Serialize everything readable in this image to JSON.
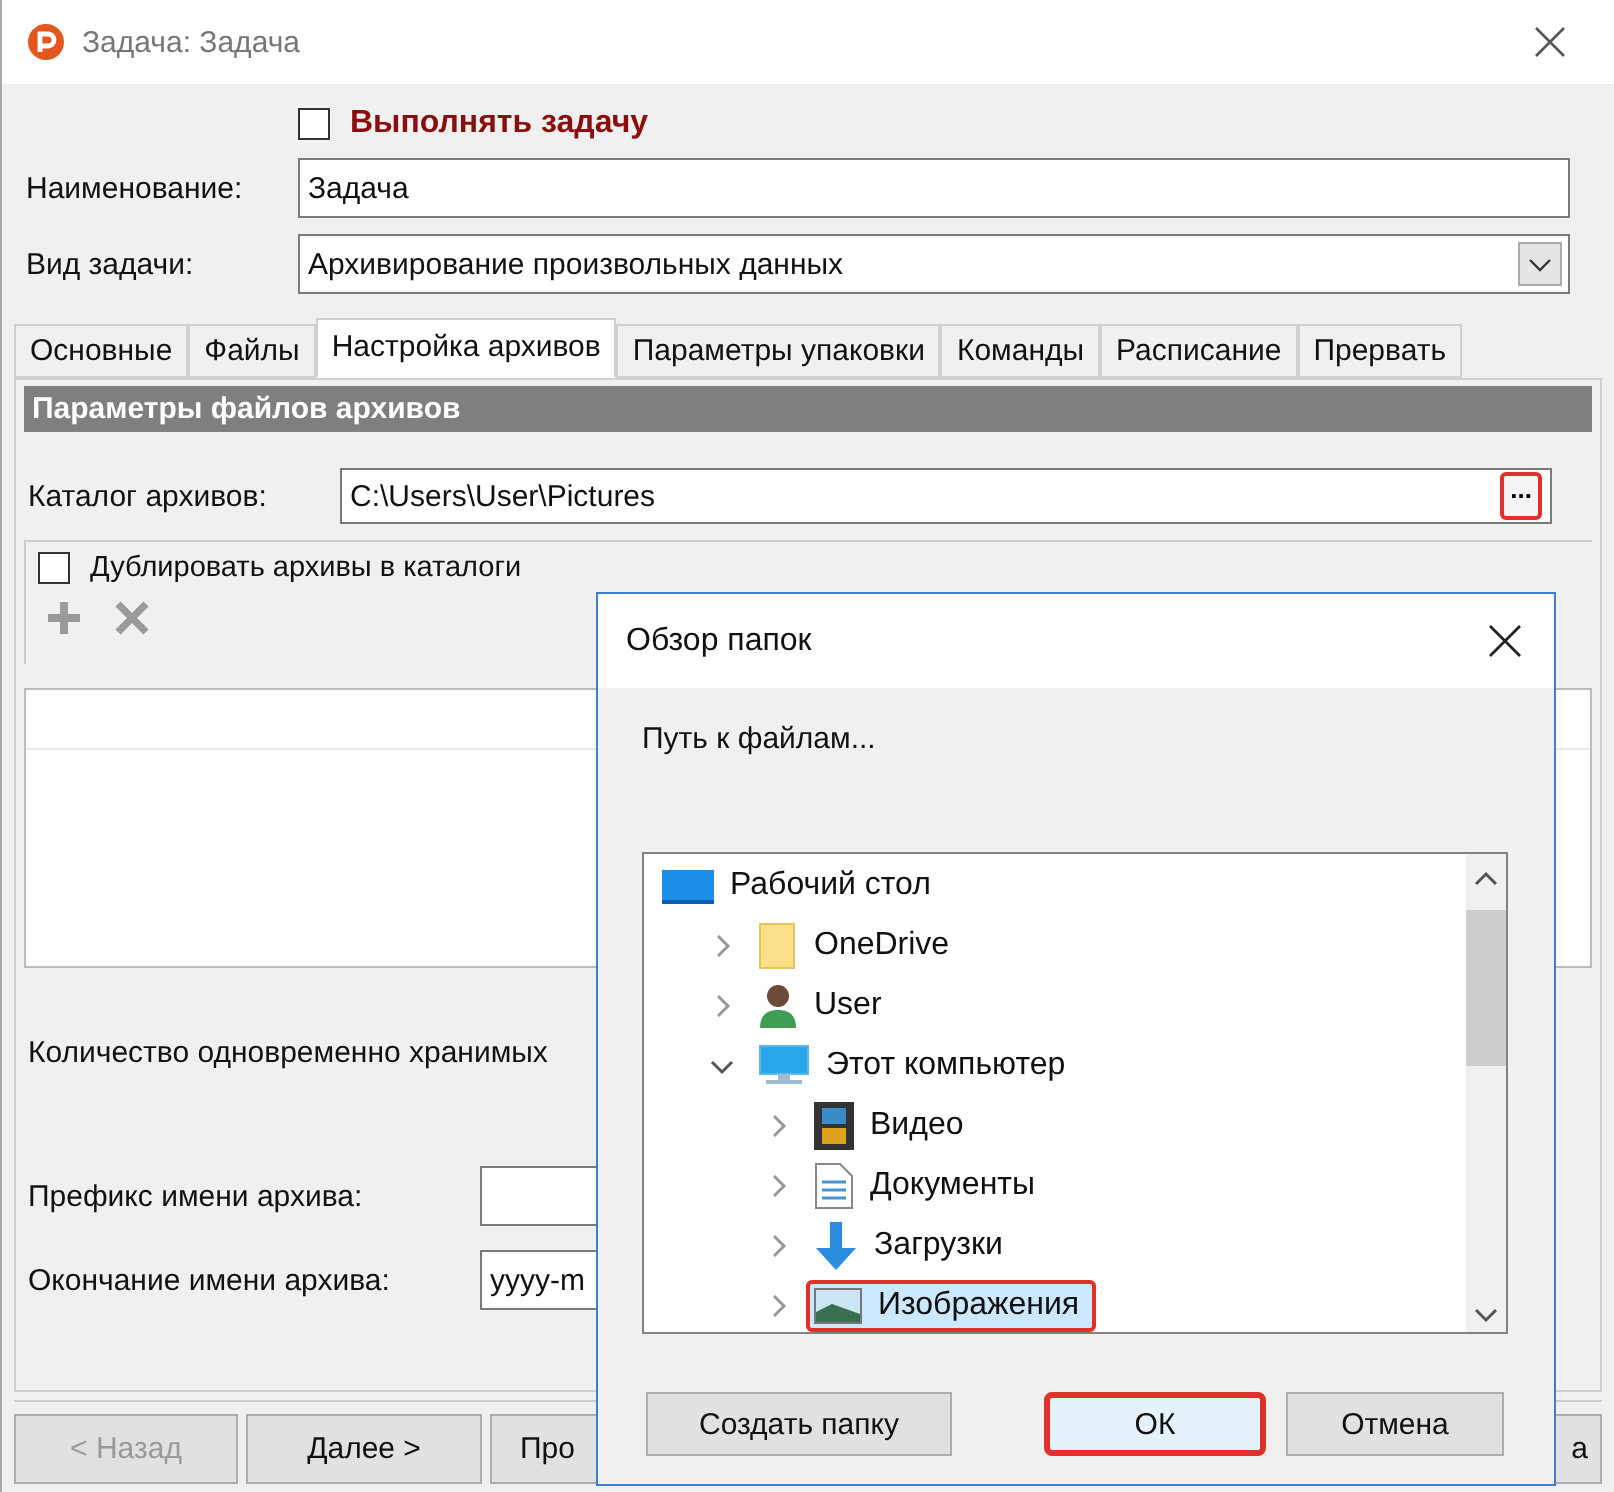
{
  "window": {
    "title": "Задача: Задача"
  },
  "run_task": {
    "label": "Выполнять задачу",
    "checked": false
  },
  "fields": [
    {
      "label": "Наименование:",
      "value": "Задача",
      "kind": "text"
    },
    {
      "label": "Вид задачи:",
      "value": "Архивирование произвольных данных",
      "kind": "dropdown"
    }
  ],
  "tabs": [
    {
      "label": "Основные",
      "selected": false
    },
    {
      "label": "Файлы",
      "selected": false
    },
    {
      "label": "Настройка архивов",
      "selected": true
    },
    {
      "label": "Параметры упаковки",
      "selected": false
    },
    {
      "label": "Команды",
      "selected": false
    },
    {
      "label": "Расписание",
      "selected": false
    },
    {
      "label": "Прервать",
      "selected": false
    }
  ],
  "section": {
    "title": "Параметры файлов архивов"
  },
  "archive_dir": {
    "label": "Каталог архивов:",
    "value": "C:\\Users\\User\\Pictures",
    "browse_label": "...",
    "browse_highlighted": true
  },
  "duplicate": {
    "label": "Дублировать архивы в каталоги",
    "checked": false
  },
  "keep_count_label": "Количество одновременно хранимых",
  "name_fields": [
    {
      "label": "Префикс имени архива:"
    },
    {
      "label": "Окончание имени архива:",
      "value": "yyyy-m"
    }
  ],
  "buttons": [
    {
      "label": "< Назад",
      "disabled": true
    },
    {
      "label": "Далее >",
      "disabled": false
    },
    {
      "label": "Про",
      "disabled": false
    },
    {
      "label": "а",
      "disabled": false
    }
  ],
  "dialog": {
    "title": "Обзор папок",
    "prompt": "Путь к файлам...",
    "tree": [
      {
        "label": "Рабочий стол",
        "kind": "desktop",
        "selected": false,
        "children": [
          {
            "label": "OneDrive",
            "kind": "folder",
            "expanded": false,
            "selected": false
          },
          {
            "label": "User",
            "kind": "user",
            "expanded": false,
            "selected": false
          },
          {
            "label": "Этот компьютер",
            "kind": "computer",
            "expanded": true,
            "selected": false,
            "children": [
              {
                "label": "Видео",
                "kind": "video",
                "expanded": false,
                "selected": false
              },
              {
                "label": "Документы",
                "kind": "documents",
                "expanded": false,
                "selected": false
              },
              {
                "label": "Загрузки",
                "kind": "downloads",
                "expanded": false,
                "selected": false
              },
              {
                "label": "Изображения",
                "kind": "pictures",
                "expanded": false,
                "selected": true,
                "highlighted": true
              }
            ]
          }
        ]
      }
    ],
    "buttons": [
      {
        "label": "Создать папку",
        "highlighted": false
      },
      {
        "label": "ОК",
        "highlighted": true
      },
      {
        "label": "Отмена",
        "highlighted": false
      }
    ]
  }
}
